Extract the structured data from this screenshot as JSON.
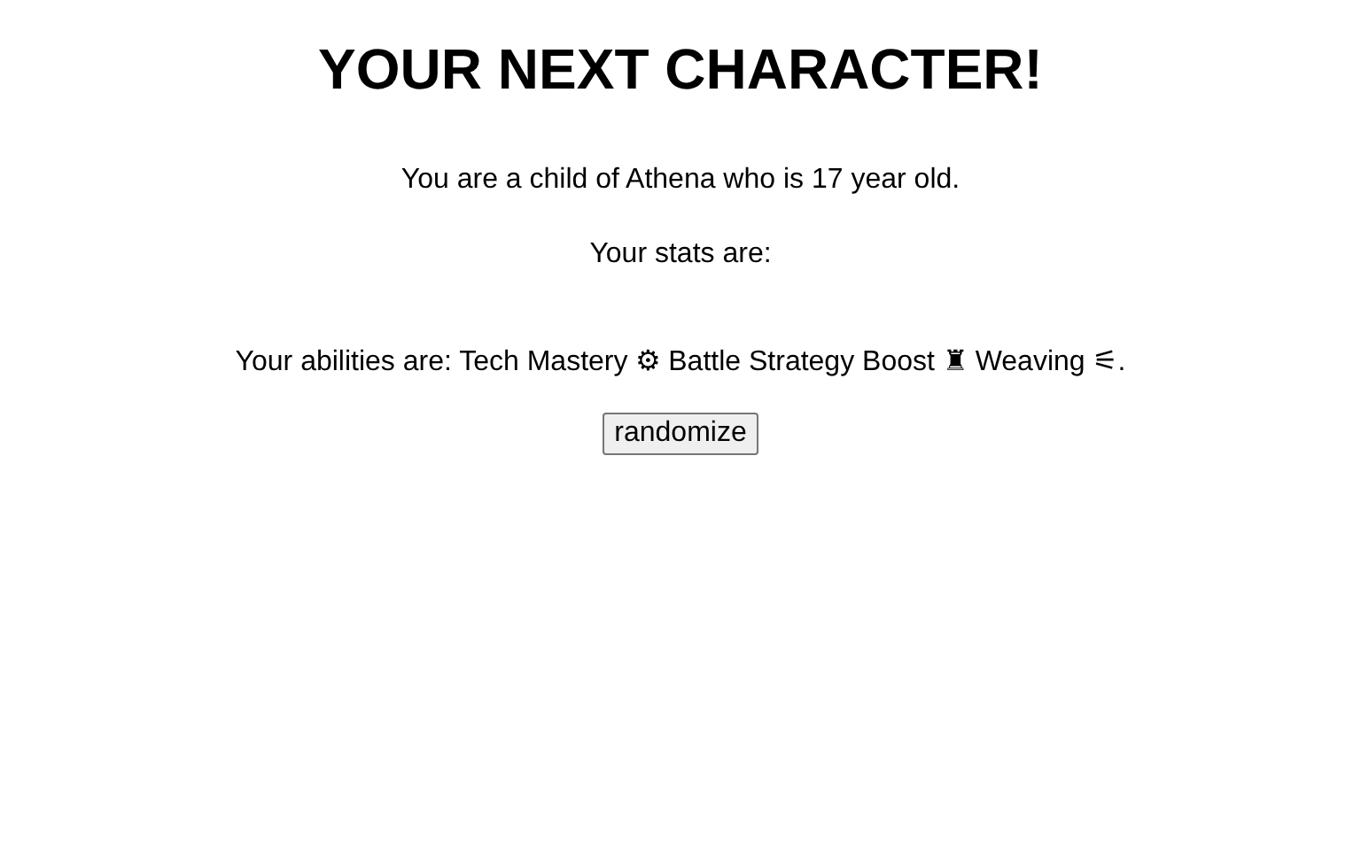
{
  "title": "YOUR NEXT CHARACTER!",
  "intro": "You are a child of Athena who is 17 year old.",
  "stats_label": "Your stats are:",
  "abilities": "Your abilities are: Tech Mastery ⚙ Battle Strategy Boost ♜ Weaving ⚟.",
  "button": "randomize"
}
